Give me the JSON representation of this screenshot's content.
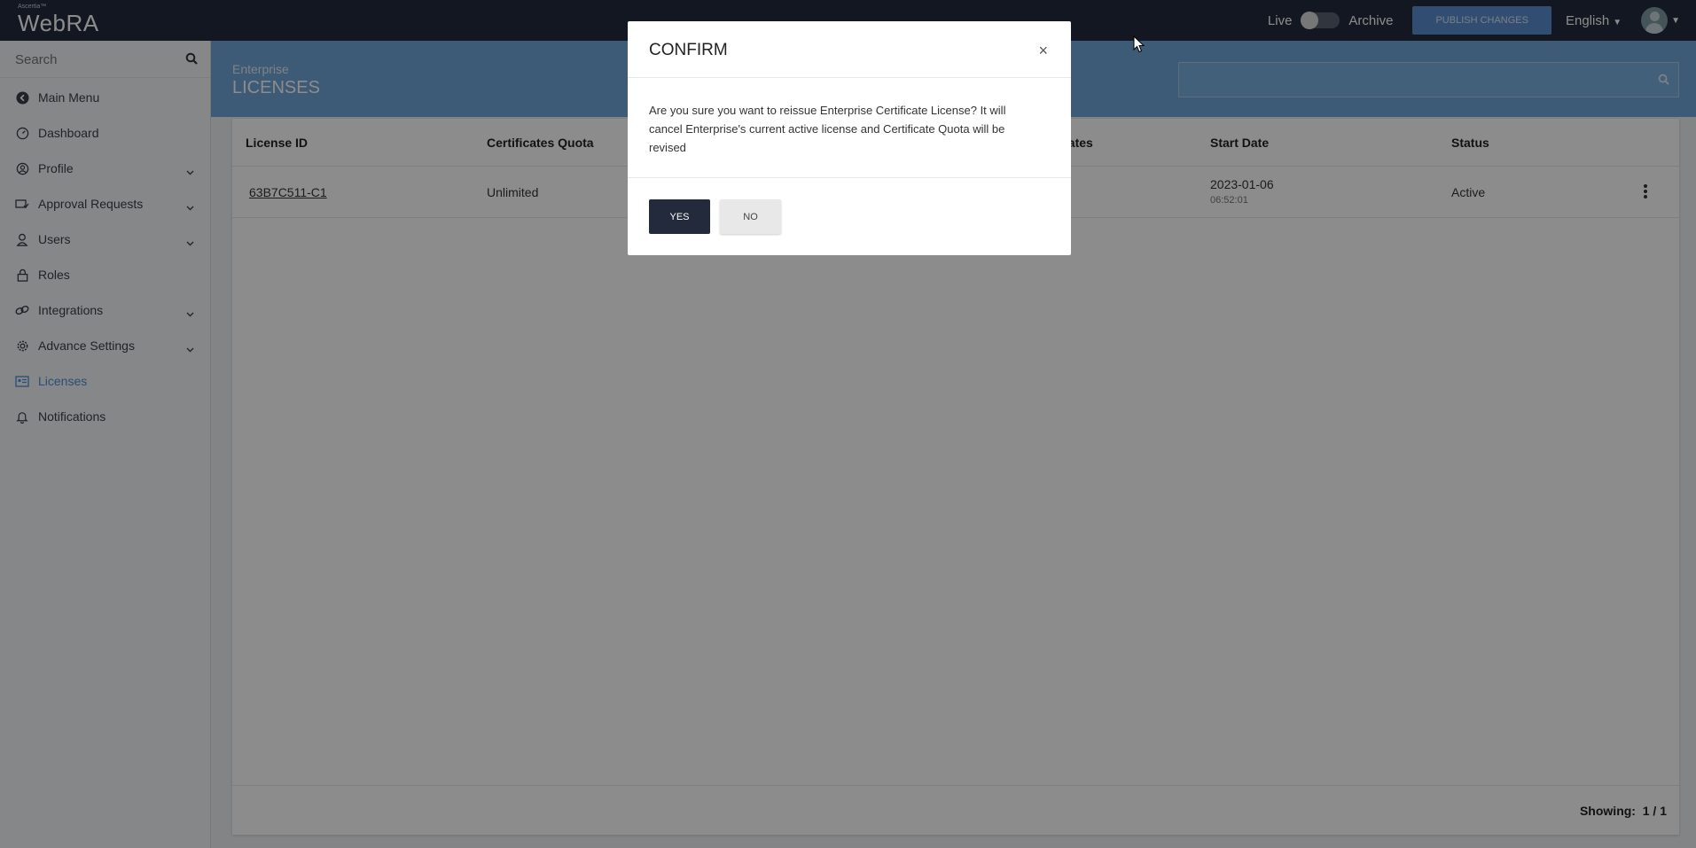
{
  "app": {
    "brand_small": "Ascertia™",
    "brand_main": "WebRA"
  },
  "topbar": {
    "live_label": "Live",
    "archive_label": "Archive",
    "publish_label": "PUBLISH CHANGES",
    "language": "English"
  },
  "sidebar": {
    "search_placeholder": "Search",
    "items": [
      {
        "label": "Main Menu",
        "icon": "back-circle-icon",
        "expandable": false,
        "active": false
      },
      {
        "label": "Dashboard",
        "icon": "dashboard-icon",
        "expandable": false,
        "active": false
      },
      {
        "label": "Profile",
        "icon": "profile-icon",
        "expandable": true,
        "active": false
      },
      {
        "label": "Approval Requests",
        "icon": "approval-icon",
        "expandable": true,
        "active": false
      },
      {
        "label": "Users",
        "icon": "users-icon",
        "expandable": true,
        "active": false
      },
      {
        "label": "Roles",
        "icon": "lock-icon",
        "expandable": false,
        "active": false
      },
      {
        "label": "Integrations",
        "icon": "link-icon",
        "expandable": true,
        "active": false
      },
      {
        "label": "Advance Settings",
        "icon": "gear-icon",
        "expandable": true,
        "active": false
      },
      {
        "label": "Licenses",
        "icon": "license-icon",
        "expandable": false,
        "active": true
      },
      {
        "label": "Notifications",
        "icon": "bell-icon",
        "expandable": false,
        "active": false
      }
    ]
  },
  "header": {
    "breadcrumb": "Enterprise",
    "title": "LICENSES"
  },
  "table": {
    "columns": [
      "License ID",
      "Certificates Quota",
      "cates",
      "Start Date",
      "Status"
    ],
    "rows": [
      {
        "license_id": "63B7C511-C1",
        "quota": "Unlimited",
        "start_date": "2023-01-06",
        "start_time": "06:52:01",
        "status": "Active"
      }
    ],
    "showing_label": "Showing:",
    "showing_value": "1 / 1"
  },
  "modal": {
    "title": "CONFIRM",
    "close": "×",
    "message": "Are you sure you want to reissue Enterprise Certificate License? It will cancel Enterprise's current active license and Certificate Quota will be revised",
    "yes_label": "YES",
    "no_label": "NO"
  },
  "colors": {
    "topbar": "#222a3c",
    "header": "#6fa5d8",
    "accent": "#4a8fd6",
    "publish": "#5a8fd0"
  }
}
